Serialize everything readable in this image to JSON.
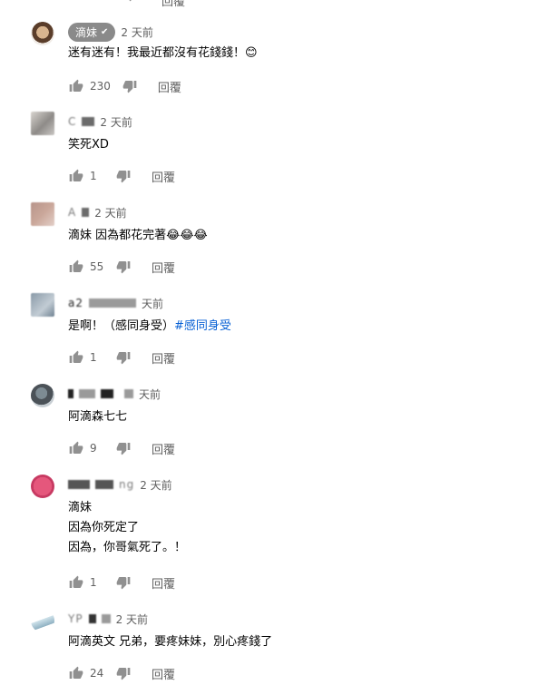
{
  "top_partial": {
    "reply_label": "回覆"
  },
  "comments": [
    {
      "badge_name": "滴妹",
      "author": "",
      "time": "2 天前",
      "lines": [
        "迷有迷有！我最近都沒有花錢錢！😊"
      ],
      "likes": "230",
      "reply_label": "回覆"
    },
    {
      "author": "C",
      "time": "2 天前",
      "lines": [
        "笑死XD"
      ],
      "likes": "1",
      "reply_label": "回覆"
    },
    {
      "author": "A",
      "time": "2 天前",
      "lines": [
        "滴妹 因為都花完著😂😂😂"
      ],
      "likes": "55",
      "reply_label": "回覆"
    },
    {
      "author": "a2",
      "time": "天前",
      "lines": [
        "是啊！（感同身受）"
      ],
      "hashtag": "#感同身受",
      "likes": "1",
      "reply_label": "回覆"
    },
    {
      "author": "",
      "time": "天前",
      "lines": [
        "阿滴森七七"
      ],
      "likes": "9",
      "reply_label": "回覆"
    },
    {
      "author": "ng",
      "time": "2 天前",
      "lines": [
        "滴妹",
        "因為你死定了",
        "因為，你哥氣死了。！"
      ],
      "likes": "1",
      "reply_label": "回覆"
    },
    {
      "author": "YP",
      "time": "2 天前",
      "lines": [
        "阿滴英文 兄弟，要疼妹妹，別心疼錢了"
      ],
      "likes": "24",
      "reply_label": "回覆"
    }
  ],
  "icons": {
    "like": "thumbs-up-icon",
    "dislike": "thumbs-down-icon",
    "verified": "checkmark-icon"
  },
  "colors": {
    "text": "#030303",
    "secondary": "#606060",
    "hashtag": "#065fd4",
    "badge_bg": "#8a8a8a"
  }
}
